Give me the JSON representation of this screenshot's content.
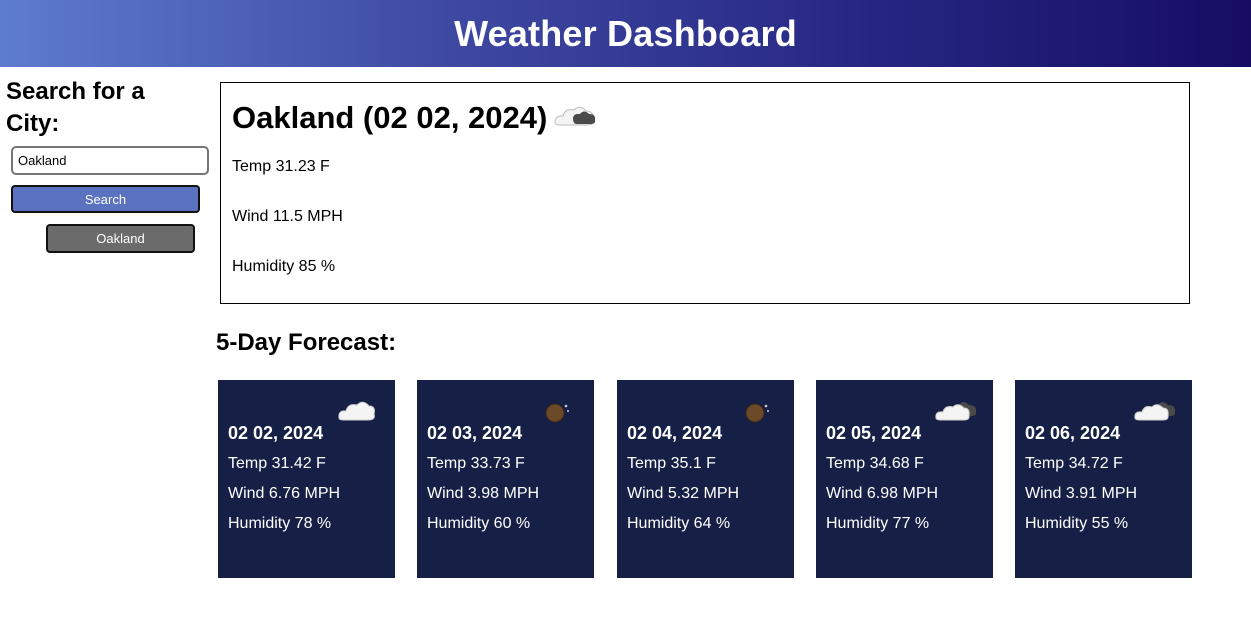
{
  "header": {
    "title": "Weather Dashboard"
  },
  "sidebar": {
    "heading": "Search for a City:",
    "search_value": "Oakland",
    "search_button": "Search",
    "history": [
      "Oakland"
    ]
  },
  "current": {
    "title": "Oakland (02 02, 2024)",
    "icon": "few-clouds-icon",
    "temp": "Temp 31.23 F",
    "wind": "Wind 11.5 MPH",
    "humidity": "Humidity 85 %"
  },
  "forecast": {
    "title": "5-Day Forecast:",
    "days": [
      {
        "date": "02 02, 2024",
        "icon": "cloud-icon",
        "temp": "Temp 31.42 F",
        "wind": "Wind 6.76 MPH",
        "humidity": "Humidity 78 %"
      },
      {
        "date": "02 03, 2024",
        "icon": "clear-night-icon",
        "temp": "Temp 33.73 F",
        "wind": "Wind 3.98 MPH",
        "humidity": "Humidity 60 %"
      },
      {
        "date": "02 04, 2024",
        "icon": "clear-night-icon",
        "temp": "Temp 35.1 F",
        "wind": "Wind 5.32 MPH",
        "humidity": "Humidity 64 %"
      },
      {
        "date": "02 05, 2024",
        "icon": "broken-clouds-icon",
        "temp": "Temp 34.68 F",
        "wind": "Wind 6.98 MPH",
        "humidity": "Humidity 77 %"
      },
      {
        "date": "02 06, 2024",
        "icon": "broken-clouds-icon",
        "temp": "Temp 34.72 F",
        "wind": "Wind 3.91 MPH",
        "humidity": "Humidity 55 %"
      }
    ]
  },
  "colors": {
    "header_gradient_start": "#5d7cd0",
    "header_gradient_end": "#160d63",
    "card_bg": "#161f45",
    "search_button_bg": "#5a72bf",
    "history_button_bg": "#6b6b6b"
  }
}
